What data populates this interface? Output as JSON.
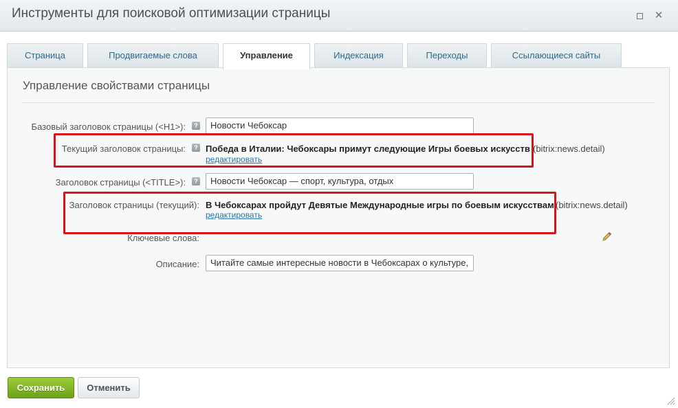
{
  "window": {
    "title": "Инструменты для поисковой оптимизации страницы",
    "maximize_icon": "maximize-icon",
    "close_icon": "close-icon",
    "close_glyph": "✕"
  },
  "tabs": [
    {
      "label": "Страница",
      "active": false
    },
    {
      "label": "Продвигаемые слова",
      "active": false
    },
    {
      "label": "Управление",
      "active": true
    },
    {
      "label": "Индексация",
      "active": false
    },
    {
      "label": "Переходы",
      "active": false
    },
    {
      "label": "Ссылающиеся сайты",
      "active": false
    }
  ],
  "section": {
    "title": "Управление свойствами страницы"
  },
  "form": {
    "h1": {
      "label": "Базовый заголовок страницы (<H1>):",
      "value": "Новости Чебоксар",
      "help": "?"
    },
    "current_h1": {
      "label": "Текущий заголовок страницы:",
      "value": "Победа в Италии: Чебоксары примут следующие Игры боевых искусств",
      "component": "(bitrix:news.detail)",
      "edit": "редактировать",
      "help": "?"
    },
    "title": {
      "label": "Заголовок страницы (<TITLE>):",
      "value": "Новости Чебоксар — спорт, культура, отдых",
      "help": "?"
    },
    "current_title": {
      "label": "Заголовок страницы (текущий):",
      "value": "В Чебоксарах пройдут Девятые Международные игры по боевым искусствам",
      "component": "(bitrix:news.detail)",
      "edit": "редактировать"
    },
    "keywords": {
      "label": "Ключевые слова:",
      "edit_icon": "pencil-icon"
    },
    "description": {
      "label": "Описание:",
      "value": "Читайте самые интересные новости в Чебоксарах о культуре,"
    }
  },
  "buttons": {
    "save": "Сохранить",
    "cancel": "Отменить"
  },
  "colors": {
    "accent_green": "#7cb224",
    "link_blue": "#2875aa",
    "highlight_red": "#d4151c"
  }
}
